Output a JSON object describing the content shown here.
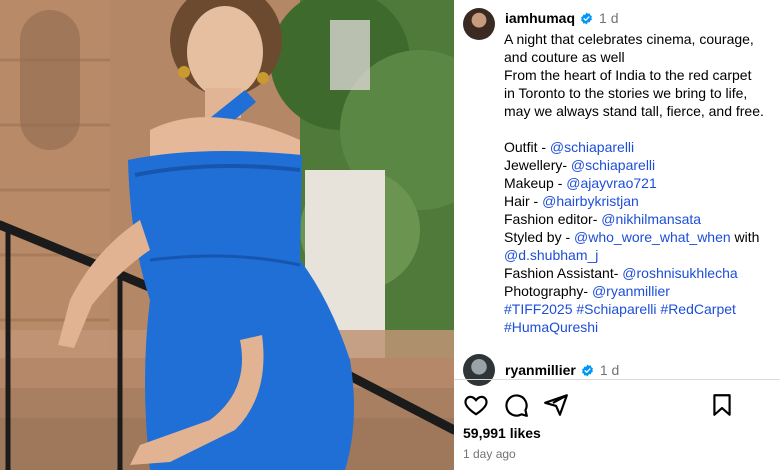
{
  "post": {
    "author": "iamhumaq",
    "time_ago": "1 d",
    "caption_lines": [
      "A night that celebrates cinema, courage,",
      "and couture as well",
      "From the heart of India to the red carpet",
      "in Toronto to the stories we bring to life,",
      "may we always stand tall, fierce, and free."
    ],
    "credits": [
      {
        "label": "Outfit - ",
        "tag": "@schiaparelli"
      },
      {
        "label": "Jewellery- ",
        "tag": "@schiaparelli"
      },
      {
        "label": "Makeup - ",
        "tag": "@ajayvrao721"
      },
      {
        "label": "Hair - ",
        "tag": "@hairbykristjan"
      },
      {
        "label": "Fashion editor- ",
        "tag": "@nikhilmansata"
      },
      {
        "label": "Styled by - ",
        "tag": "@who_wore_what_when",
        "suffix": " with"
      },
      {
        "label": "",
        "tag": "@d.shubham_j"
      },
      {
        "label": "Fashion Assistant- ",
        "tag": "@roshnisukhlecha"
      },
      {
        "label": "Photography- ",
        "tag": "@ryanmillier"
      }
    ],
    "hashtags_line1": "#TIFF2025 #Schiaparelli #RedCarpet",
    "hashtags_line2": "#HumaQureshi"
  },
  "comment": {
    "author": "ryanmillier",
    "time_ago": "1 d"
  },
  "stats": {
    "likes": "59,991 likes",
    "posted": "1 day ago"
  },
  "icons": {
    "like": "heart-icon",
    "comment": "comment-icon",
    "share": "share-icon",
    "save": "bookmark-icon",
    "verified": "verified-badge-icon"
  },
  "colors": {
    "tag_link": "#1d4ed8",
    "verified": "#0095f6",
    "muted": "#737373",
    "dress": "#1f6fd6"
  }
}
